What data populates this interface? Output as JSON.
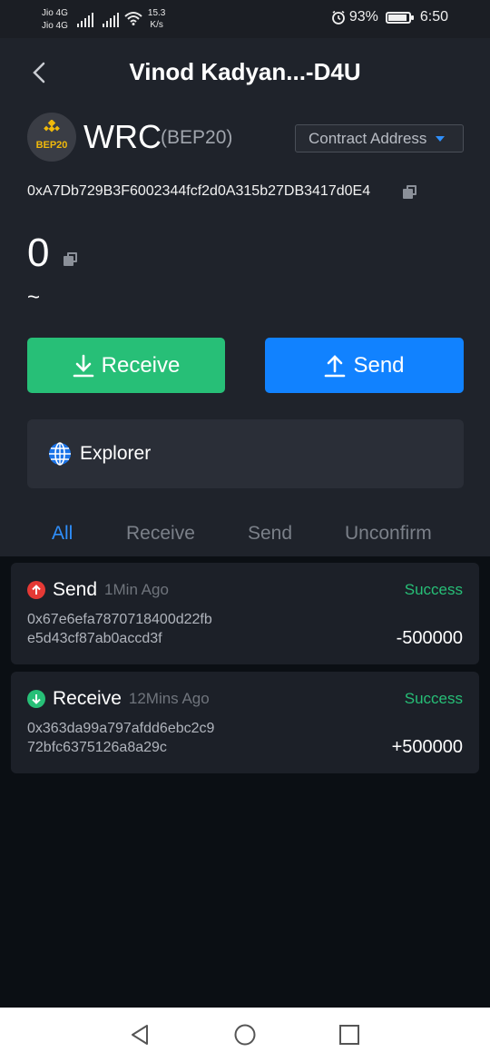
{
  "status_bar": {
    "carrier_1": "Jio 4G",
    "carrier_2": "Jio 4G",
    "speed_value": "15.3",
    "speed_unit": "K/s",
    "battery_percent": "93%",
    "battery_level": 0.93,
    "clock": "6:50",
    "icons": [
      "signal-icon",
      "signal-icon",
      "wifi-icon",
      "alarm-icon",
      "battery-icon"
    ]
  },
  "header": {
    "title": "Vinod Kadyan...-D4U",
    "back_icon": "chevron-left-icon"
  },
  "token": {
    "logo_label": "BEP20",
    "logo_icon": "binance-icon",
    "symbol": "WRC",
    "standard": "(BEP20)",
    "contract_button_label": "Contract Address",
    "contract_icon": "caret-down-icon",
    "address": "0xA7Db729B3F6002344fcf2d0A315b27DB3417d0E4",
    "balance": "0",
    "fiat_value": "~"
  },
  "actions": {
    "receive_label": "Receive",
    "send_label": "Send",
    "receive_icon": "download-icon",
    "send_icon": "upload-icon"
  },
  "explorer": {
    "label": "Explorer",
    "icon": "globe-icon"
  },
  "tabs": [
    {
      "label": "All",
      "active": true
    },
    {
      "label": "Receive",
      "active": false
    },
    {
      "label": "Send",
      "active": false
    },
    {
      "label": "Unconfirm",
      "active": false
    }
  ],
  "transactions": [
    {
      "type": "Send",
      "time": "1Min Ago",
      "status": "Success",
      "hash_line_1": "0x67e6efa7870718400d22fb",
      "hash_line_2": "e5d43cf87ab0accd3f",
      "amount": "-500000",
      "icon": "arrow-up-icon"
    },
    {
      "type": "Receive",
      "time": "12Mins Ago",
      "status": "Success",
      "hash_line_1": "0x363da99a797afdd6ebc2c9",
      "hash_line_2": "72bfc6375126a8a29c",
      "amount": "+500000",
      "icon": "arrow-down-icon"
    }
  ],
  "colors": {
    "accent_blue": "#1182ff",
    "accent_green": "#27bf77",
    "accent_red": "#e53935",
    "background": "#0b0f14",
    "panel": "#1f232b"
  },
  "nav_bar": {
    "icons": [
      "back-triangle-icon",
      "home-circle-icon",
      "recents-square-icon"
    ]
  }
}
